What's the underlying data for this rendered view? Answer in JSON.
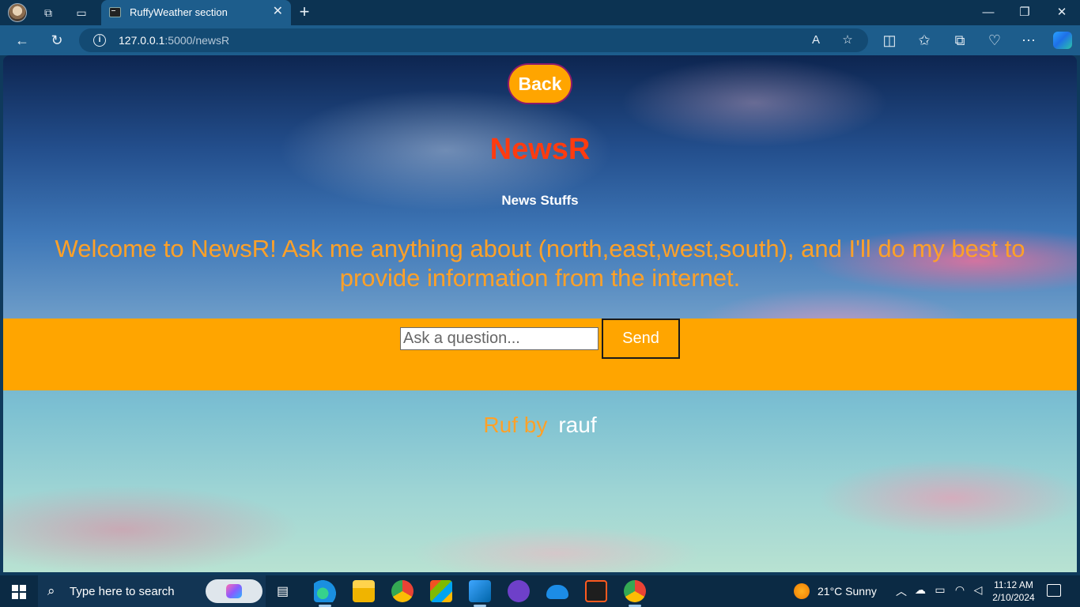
{
  "browser": {
    "tab_title": "RuffyWeather section",
    "url_host": "127.0.0.1",
    "url_path": ":5000/newsR"
  },
  "page": {
    "back_label": "Back",
    "title": "NewsR",
    "subtitle": "News Stuffs",
    "welcome": "Welcome to NewsR! Ask me anything about (north,east,west,south), and I'll do my best to provide information from the internet.",
    "input_placeholder": "Ask a question...",
    "send_label": "Send",
    "footer_by": "Ruf by",
    "footer_author": "rauf"
  },
  "taskbar": {
    "search_placeholder": "Type here to search",
    "weather": "21°C  Sunny",
    "time": "11:12 AM",
    "date": "2/10/2024"
  },
  "colors": {
    "accent_orange": "#ffa500",
    "title_red": "#ff3b0f",
    "welcome_orange": "#ffa128"
  }
}
